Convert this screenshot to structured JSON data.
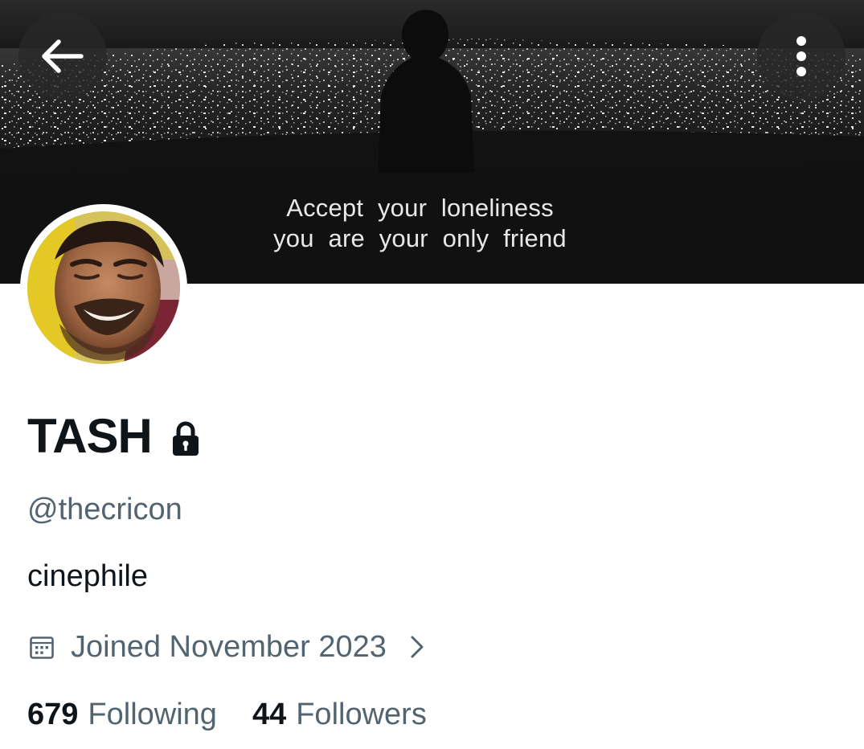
{
  "header": {
    "banner_caption_line1": "Accept your loneliness",
    "banner_caption_line2": "you are your only friend",
    "back_icon": "arrow-left-icon",
    "more_icon": "vertical-ellipsis-icon"
  },
  "profile": {
    "display_name": "TASH",
    "protected_icon": "lock-icon",
    "handle": "@thecricon",
    "bio": "cinephile",
    "joined": "Joined November 2023",
    "joined_icon": "calendar-icon",
    "joined_chevron_icon": "chevron-right-icon"
  },
  "stats": {
    "following_count": "679",
    "following_label": "Following",
    "followers_count": "44",
    "followers_label": "Followers"
  },
  "colors": {
    "primary_text": "#0f1419",
    "secondary_text": "#536471",
    "background": "#ffffff",
    "overlay_button": "#282828"
  }
}
